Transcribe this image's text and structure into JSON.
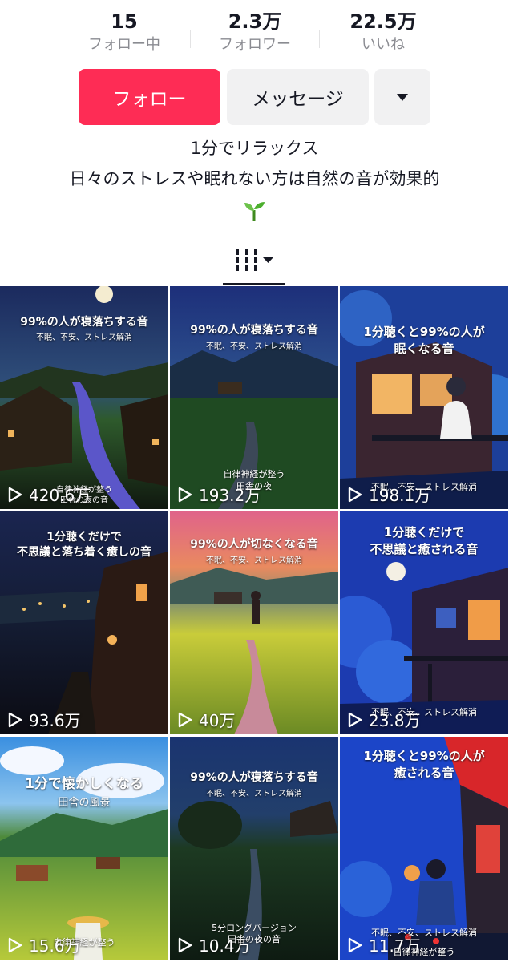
{
  "stats": [
    {
      "value": "15",
      "label": "フォロー中"
    },
    {
      "value": "2.3万",
      "label": "フォロワー"
    },
    {
      "value": "22.5万",
      "label": "いいね"
    }
  ],
  "buttons": {
    "follow": "フォロー",
    "message": "メッセージ",
    "more_icon": "triangle-down-icon"
  },
  "bio": {
    "line1": "1分でリラックス",
    "line2": "日々のストレスや眠れない方は自然の音が効果的",
    "emoji": "🌱"
  },
  "tab": {
    "icon": "grid-icon",
    "dropdown_icon": "triangle-down-icon"
  },
  "videos": [
    {
      "title": "99%の人が寝落ちする音",
      "subtitle": "不眠、不安、ストレス解消",
      "bottom_text": [
        "自律神経が整う",
        "田舎の夜の音"
      ],
      "views": "420.6万"
    },
    {
      "title": "99%の人が寝落ちする音",
      "subtitle": "不眠、不安、ストレス解消",
      "bottom_text": [
        "自律神経が整う",
        "田舎の夜"
      ],
      "views": "193.2万"
    },
    {
      "title": "1分聴くと99%の人が\n眠くなる音",
      "subtitle": "",
      "bottom_text": [
        "不眠、不安、ストレス解消"
      ],
      "views": "198.1万"
    },
    {
      "title": "1分聴くだけで\n不思議と落ち着く癒しの音",
      "subtitle": "",
      "bottom_text": [],
      "views": "93.6万"
    },
    {
      "title": "99%の人が切なくなる音",
      "subtitle": "不眠、不安、ストレス解消",
      "bottom_text": [],
      "views": "40万"
    },
    {
      "title": "1分聴くだけで\n不思議と癒される音",
      "subtitle": "",
      "bottom_text": [
        "不眠、不安、ストレス解消"
      ],
      "views": "23.8万"
    },
    {
      "title": "1分で懐かしくなる",
      "subtitle": "田舎の風景",
      "bottom_text": [
        "自律神経が整う"
      ],
      "views": "15.6万"
    },
    {
      "title": "99%の人が寝落ちする音",
      "subtitle": "不眠、不安、ストレス解消",
      "bottom_text": [
        "5分ロングバージョン",
        "田舎の夜の音"
      ],
      "views": "10.4万"
    },
    {
      "title": "1分聴くと99%の人が\n癒される音",
      "subtitle": "",
      "bottom_text": [
        "不眠、不安、ストレス解消",
        "自律神経が整う"
      ],
      "views": "11.7万"
    }
  ],
  "colors": {
    "accent": "#fe2c55",
    "button_gray": "#f1f1f2",
    "text": "#161823",
    "muted": "#8a8b91"
  }
}
